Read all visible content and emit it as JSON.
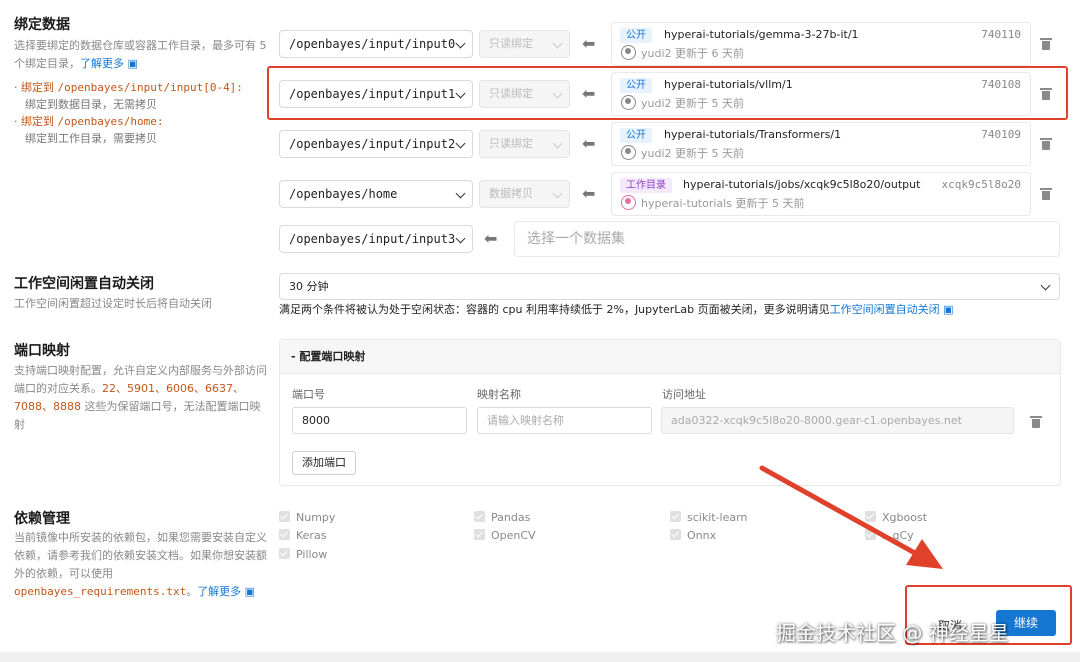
{
  "bind_section": {
    "title": "绑定数据",
    "desc": "选择要绑定的数据仓库或容器工作目录，最多可有 5 个绑定目录，",
    "learn_more": "了解更多",
    "rule1_prefix": "绑定到",
    "rule1_path": "/openbayes/input/input[0-4]:",
    "rule1_desc": "绑定到数据目录，无需拷贝",
    "rule2_prefix": "绑定到",
    "rule2_path": "/openbayes/home:",
    "rule2_desc": "绑定到工作目录，需要拷贝"
  },
  "bindings": [
    {
      "path": "/openbayes/input/input0",
      "mode": "只读绑定",
      "badge": "公开",
      "badge_type": "pub",
      "name": "hyperai-tutorials/gemma-3-27b-it/1",
      "id": "740110",
      "user": "yudi2",
      "updated": "更新于 6 天前"
    },
    {
      "path": "/openbayes/input/input1",
      "mode": "只读绑定",
      "badge": "公开",
      "badge_type": "pub",
      "name": "hyperai-tutorials/vllm/1",
      "id": "740108",
      "user": "yudi2",
      "updated": "更新于 5 天前"
    },
    {
      "path": "/openbayes/input/input2",
      "mode": "只读绑定",
      "badge": "公开",
      "badge_type": "pub",
      "name": "hyperai-tutorials/Transformers/1",
      "id": "740109",
      "user": "yudi2",
      "updated": "更新于 5 天前"
    },
    {
      "path": "/openbayes/home",
      "mode": "数据拷贝",
      "badge": "工作目录",
      "badge_type": "work",
      "name": "hyperai-tutorials/jobs/xcqk9c5l8o20/output",
      "id": "xcqk9c5l8o20",
      "user": "hyperai-tutorials",
      "updated": "更新于 5 天前"
    }
  ],
  "empty_binding": {
    "path": "/openbayes/input/input3",
    "placeholder": "选择一个数据集"
  },
  "idle_section": {
    "title": "工作空间闲置自动关闭",
    "desc": "工作空间闲置超过设定时长后将自动关闭",
    "value": "30 分钟",
    "note": "满足两个条件将被认为处于空闲状态：容器的 cpu 利用率持续低于 2%，JupyterLab 页面被关闭，更多说明请见",
    "note_link": "工作空间闲置自动关闭"
  },
  "port_section": {
    "title": "端口映射",
    "desc_1": "支持端口映射配置，允许自定义内部服务与外部访问端口的对应关系。",
    "reserved_ports": "22、5901、6006、6637、7088、8888",
    "desc_2": "这些为保留端口号，无法配置端口映射",
    "panel_title": "- 配置端口映射",
    "col_port": "端口号",
    "col_name": "映射名称",
    "col_url": "访问地址",
    "port_value": "8000",
    "name_placeholder": "请输入映射名称",
    "url_value": "ada0322-xcqk9c5l8o20-8000.gear-c1.openbayes.net",
    "add_button": "添加端口"
  },
  "deps_section": {
    "title": "依赖管理",
    "desc": "当前镜像中所安装的依赖包，如果您需要安装自定义依赖，请参考我们的依赖安装文档。如果你想安装额外的依赖，可以使用",
    "req_file": "openbayes_requirements.txt",
    "learn_more": "了解更多",
    "packages": [
      "Numpy",
      "Pandas",
      "scikit-learn",
      "Xgboost",
      "Keras",
      "OpenCV",
      "Onnx",
      "...gCy",
      "Pillow"
    ]
  },
  "footer": {
    "cancel": "取消",
    "confirm": "继续",
    "watermark": "掘金技术社区 @ 神经星星"
  },
  "colors": {
    "accent": "#1677d2",
    "highlight_box": "#e0412b",
    "reserved_port": "#c2571a"
  }
}
